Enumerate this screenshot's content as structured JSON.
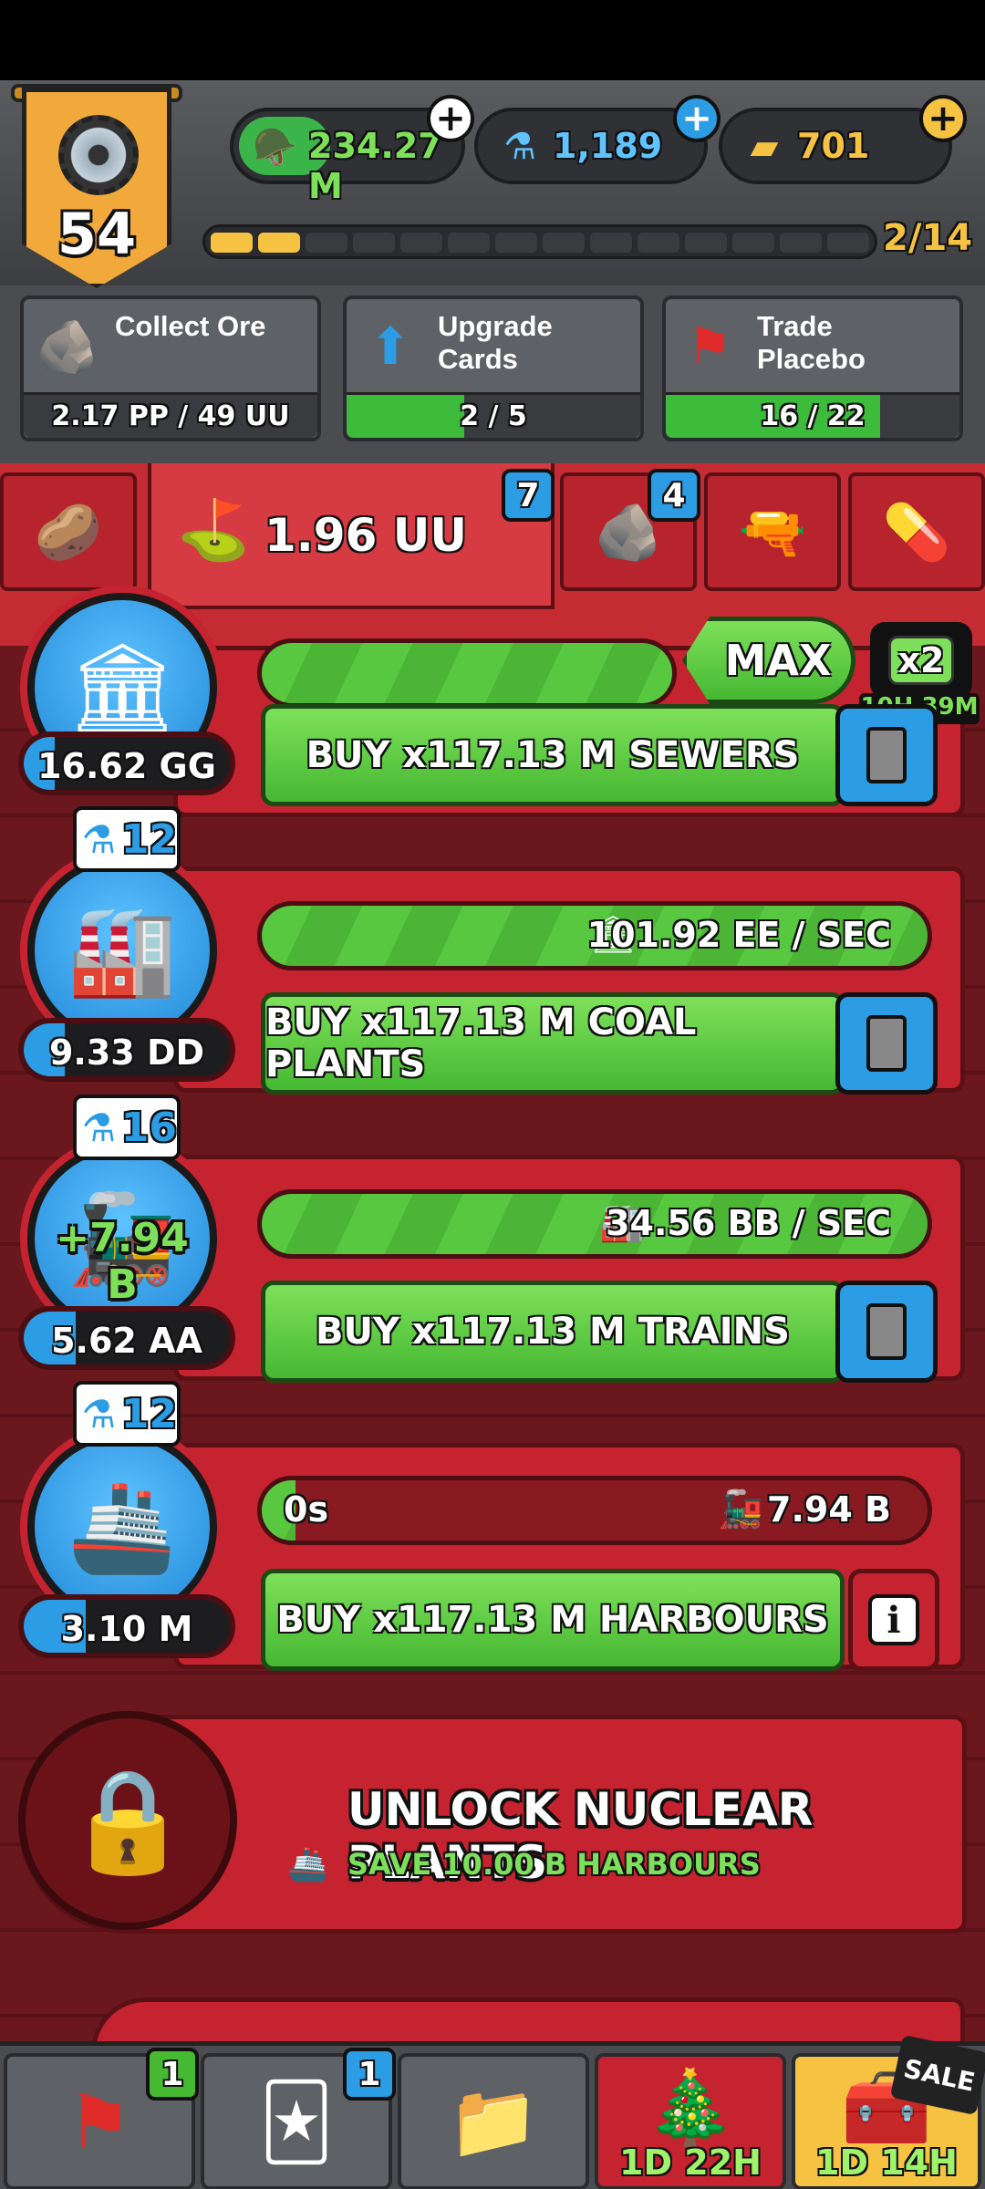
{
  "player": {
    "level": "54"
  },
  "currencies": {
    "cash": {
      "value": "234.27 M",
      "icon": "army-cap-icon"
    },
    "science": {
      "value": "1,189",
      "icon": "flask-icon"
    },
    "gold": {
      "value": "701",
      "icon": "gold-bars-icon"
    }
  },
  "level_progress": {
    "text": "2/14",
    "current": 2,
    "total": 14
  },
  "quests": [
    {
      "title_line1": "Collect Ore",
      "title_line2": "",
      "progress_text": "2.17 PP / 49 UU",
      "progress_fraction": 0.0
    },
    {
      "title_line1": "Upgrade",
      "title_line2": "Cards",
      "progress_text": "2 / 5",
      "progress_fraction": 0.4
    },
    {
      "title_line1": "Trade",
      "title_line2": "Placebo",
      "progress_text": "16 / 22",
      "progress_fraction": 0.73
    }
  ],
  "tabs": {
    "active_value": "1.96 UU",
    "badge_a": "7",
    "badge_b": "4"
  },
  "boost": {
    "max_label": "MAX",
    "multiplier": "x2",
    "time_left": "10H 39M"
  },
  "industries": [
    {
      "name": "sewers",
      "value": "16.62 GG",
      "value_fill": 0.15,
      "buy_label": "BUY x117.13 M SEWERS"
    },
    {
      "name": "coal-plants",
      "research": "12",
      "value": "9.33 DD",
      "value_fill": 0.2,
      "rate": "101.92 EE / SEC",
      "rate_fill": 1.0,
      "buy_label": "BUY x117.13 M COAL PLANTS"
    },
    {
      "name": "trains",
      "research": "16",
      "value": "5.62 AA",
      "value_fill": 0.25,
      "boost_popup": "+7.94 B",
      "rate": "34.56 BB / SEC",
      "rate_fill": 1.0,
      "buy_label": "BUY x117.13 M TRAINS"
    },
    {
      "name": "harbours",
      "research": "12",
      "value": "3.10 M",
      "value_fill": 0.3,
      "timer": "0s",
      "rate": "7.94 B",
      "rate_fill": 0.05,
      "buy_label": "BUY x117.13 M HARBOURS",
      "info": "i"
    }
  ],
  "locked": {
    "title": "UNLOCK NUCLEAR PLANTS",
    "requirement": "SAVE 10.00 B HARBOURS"
  },
  "bottom_nav": {
    "missions_badge": "1",
    "cards_badge": "1",
    "event_timer": "1D 22H",
    "shop_timer": "1D 14H",
    "sale_label": "SALE"
  },
  "colors": {
    "accent_green": "#46b832",
    "accent_blue": "#2c9de4",
    "panel_red": "#c4232f",
    "gold": "#f5c242"
  }
}
